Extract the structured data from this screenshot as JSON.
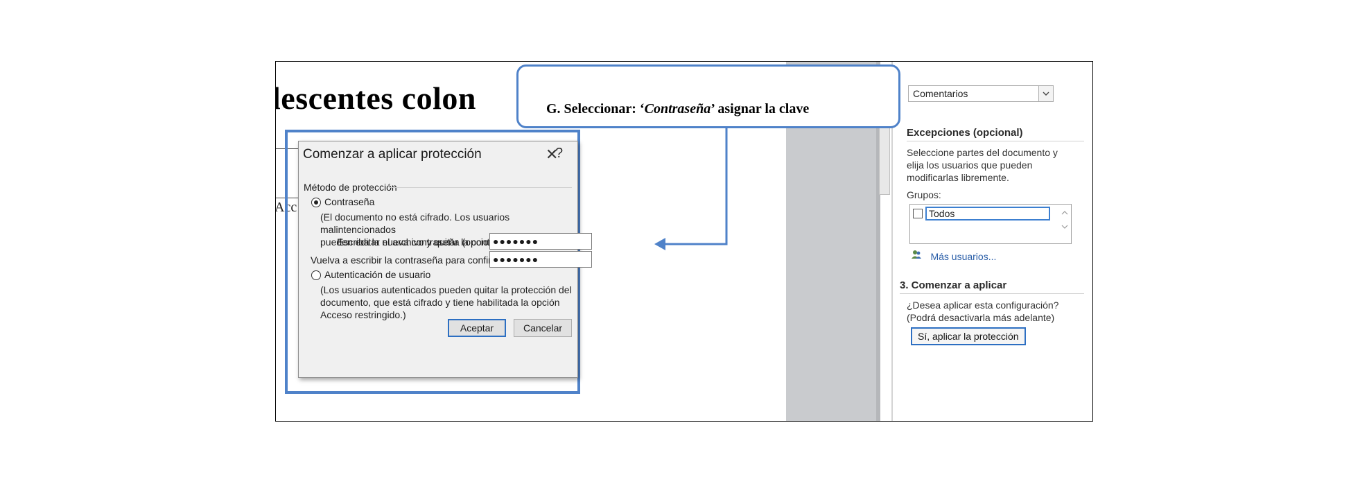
{
  "document": {
    "heading_fragment": "lescentes  colon",
    "partial_text": "Acc"
  },
  "callout": {
    "prefix": "G. Seleccionar: ‘",
    "emphasis": "Contraseña",
    "suffix": "’ asignar la clave"
  },
  "dialog": {
    "title": "Comenzar a aplicar protección",
    "help_glyph": "?",
    "close_glyph": "✕",
    "section_label": "Método de protección",
    "option_password": {
      "label": "Contraseña",
      "selected": true,
      "desc_line1": "(El documento no está cifrado. Los usuarios malintencionados",
      "desc_line2": "pueden editar el archivo y quitar la contraseña.)"
    },
    "new_password": {
      "label": "Escriba la nueva contraseña (opcional):",
      "value": "●●●●●●●"
    },
    "confirm_password": {
      "label": "Vuelva a escribir la contraseña para confirmar:",
      "value": "●●●●●●●"
    },
    "option_user_auth": {
      "label": "Autenticación de usuario",
      "selected": false,
      "desc_line1": "(Los usuarios autenticados pueden quitar la protección del",
      "desc_line2": "documento, que está cifrado y tiene habilitada la opción",
      "desc_line3": "Acceso restringido.)"
    },
    "ok_label": "Aceptar",
    "cancel_label": "Cancelar"
  },
  "task_pane": {
    "select_value": "Comentarios",
    "exceptions_heading": "Excepciones (opcional)",
    "exceptions_desc_line1": "Seleccione partes del documento y",
    "exceptions_desc_line2": "elija los usuarios que pueden",
    "exceptions_desc_line3": "modificarlas libremente.",
    "groups_label": "Grupos:",
    "groups_item": "Todos",
    "more_users": "Más usuarios...",
    "step3_heading": "3. Comenzar a aplicar",
    "step3_desc_line1": "¿Desea aplicar esta configuración?",
    "step3_desc_line2": "(Podrá desactivarla más adelante)",
    "apply_button": "Sí, aplicar la protección"
  },
  "colors": {
    "annotation_blue": "#4f82c9",
    "default_button_border": "#2d6fc2",
    "link_blue": "#2a5ea8"
  },
  "icons": {
    "help": "question-mark-icon",
    "close": "close-icon",
    "dropdown": "chevron-down-icon",
    "users": "users-icon"
  }
}
